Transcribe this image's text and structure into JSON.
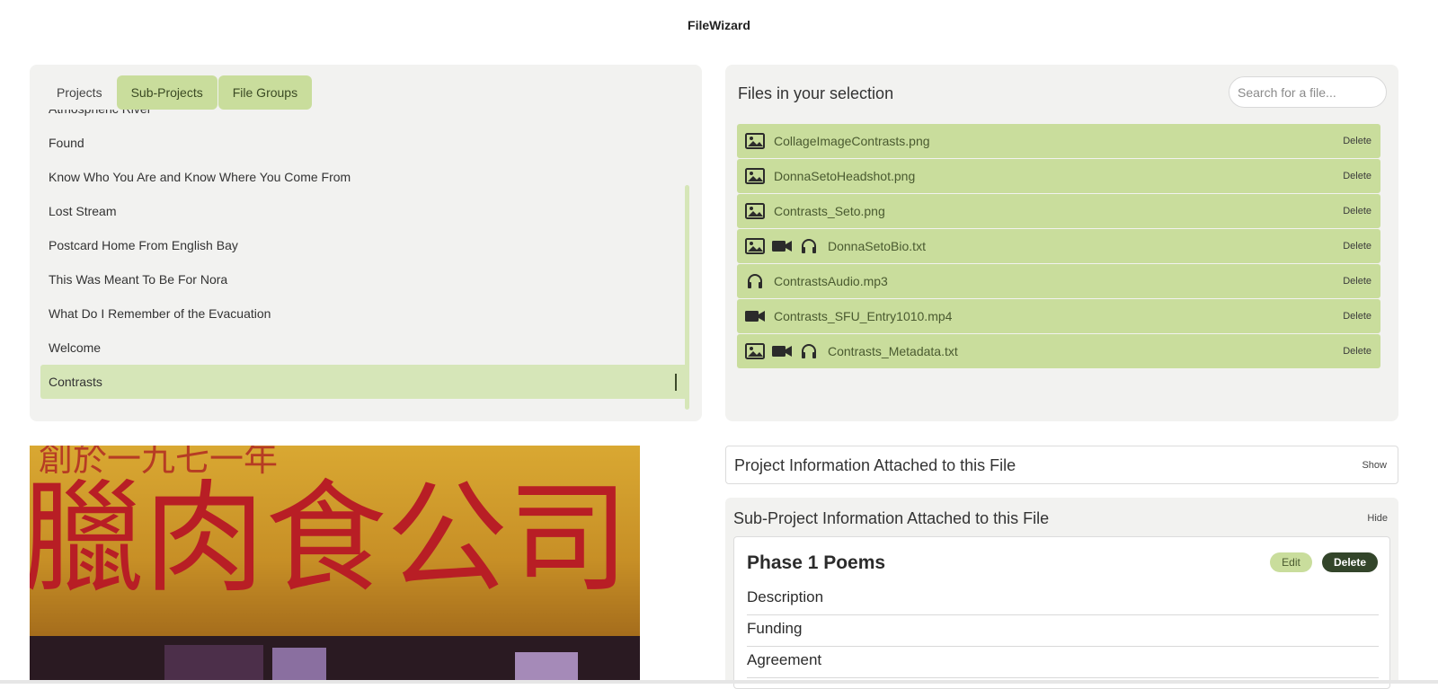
{
  "app": {
    "title": "FileWizard"
  },
  "tabs": [
    {
      "label": "Projects",
      "active": false
    },
    {
      "label": "Sub-Projects",
      "active": true
    },
    {
      "label": "File Groups",
      "active": true
    }
  ],
  "projects": [
    "Atmospheric River",
    "Found",
    "Know Who You Are and Know Where You Come From",
    "Lost Stream",
    "Postcard Home From English Bay",
    "This Was Meant To Be For Nora",
    "What Do I Remember of the Evacuation",
    "Welcome",
    "Contrasts"
  ],
  "selected_project": "Contrasts",
  "files_panel": {
    "heading": "Files in your selection",
    "search_placeholder": "Search for a file...",
    "delete_label": "Delete",
    "files": [
      {
        "name": "CollageImageContrasts.png",
        "icons": [
          "image-icon"
        ]
      },
      {
        "name": "DonnaSetoHeadshot.png",
        "icons": [
          "image-icon"
        ]
      },
      {
        "name": "Contrasts_Seto.png",
        "icons": [
          "image-icon"
        ]
      },
      {
        "name": "DonnaSetoBio.txt",
        "icons": [
          "image-icon",
          "video-icon",
          "headphones-icon"
        ]
      },
      {
        "name": "ContrastsAudio.mp3",
        "icons": [
          "headphones-icon"
        ]
      },
      {
        "name": "Contrasts_SFU_Entry1010.mp4",
        "icons": [
          "video-icon"
        ]
      },
      {
        "name": "Contrasts_Metadata.txt",
        "icons": [
          "image-icon",
          "video-icon",
          "headphones-icon"
        ]
      }
    ]
  },
  "project_info": {
    "title": "Project Information Attached to this File",
    "toggle": "Show"
  },
  "subproject_info": {
    "title": "Sub-Project Information Attached to this File",
    "toggle": "Hide",
    "card": {
      "title": "Phase 1 Poems",
      "edit_label": "Edit",
      "delete_label": "Delete",
      "fields": [
        "Description",
        "Funding",
        "Agreement"
      ]
    }
  },
  "colors": {
    "accent": "#c9dd9c",
    "accent_light": "#d6e6b8",
    "dark": "#33452a",
    "panel": "#f2f2f0"
  },
  "preview": {
    "sign_text": "臘肉食公司",
    "sign_top_text": "創於一九七一年"
  }
}
